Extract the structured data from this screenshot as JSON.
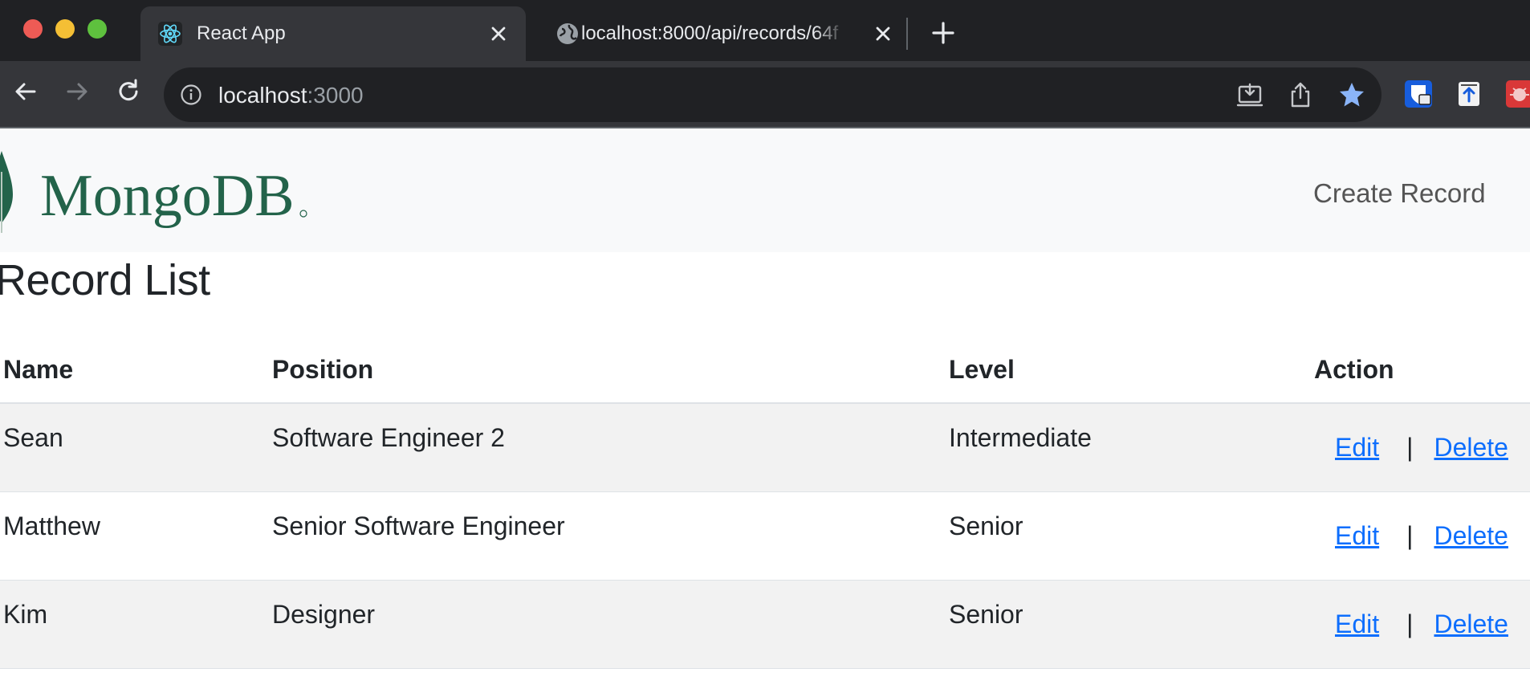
{
  "browser": {
    "tabs": [
      {
        "title": "React App",
        "favicon": "react-icon",
        "active": true
      },
      {
        "title": "localhost:8000/api/records/64f",
        "favicon": "globe-icon",
        "active": false
      }
    ],
    "address": {
      "host": "localhost",
      "port": ":3000"
    },
    "colors": {
      "chrome_dark": "#202124",
      "chrome_tab": "#35363a",
      "bookmark_star": "#8ab4f8"
    }
  },
  "navbar": {
    "brand": "MongoDB",
    "brand_color": "#23634a",
    "leaf_color": "#23634a",
    "create_link": "Create Record"
  },
  "page": {
    "title": "Record List"
  },
  "table": {
    "headers": [
      "Name",
      "Position",
      "Level",
      "Action"
    ],
    "rows": [
      {
        "name": "Sean",
        "position": "Software Engineer 2",
        "level": "Intermediate",
        "edit": "Edit",
        "separator": "|",
        "delete": "Delete"
      },
      {
        "name": "Matthew",
        "position": "Senior Software Engineer",
        "level": "Senior",
        "edit": "Edit",
        "separator": "|",
        "delete": "Delete"
      },
      {
        "name": "Kim",
        "position": "Designer",
        "level": "Senior",
        "edit": "Edit",
        "separator": "|",
        "delete": "Delete"
      }
    ],
    "link_color": "#0d6efd",
    "stripe_color": "#f2f2f2"
  }
}
